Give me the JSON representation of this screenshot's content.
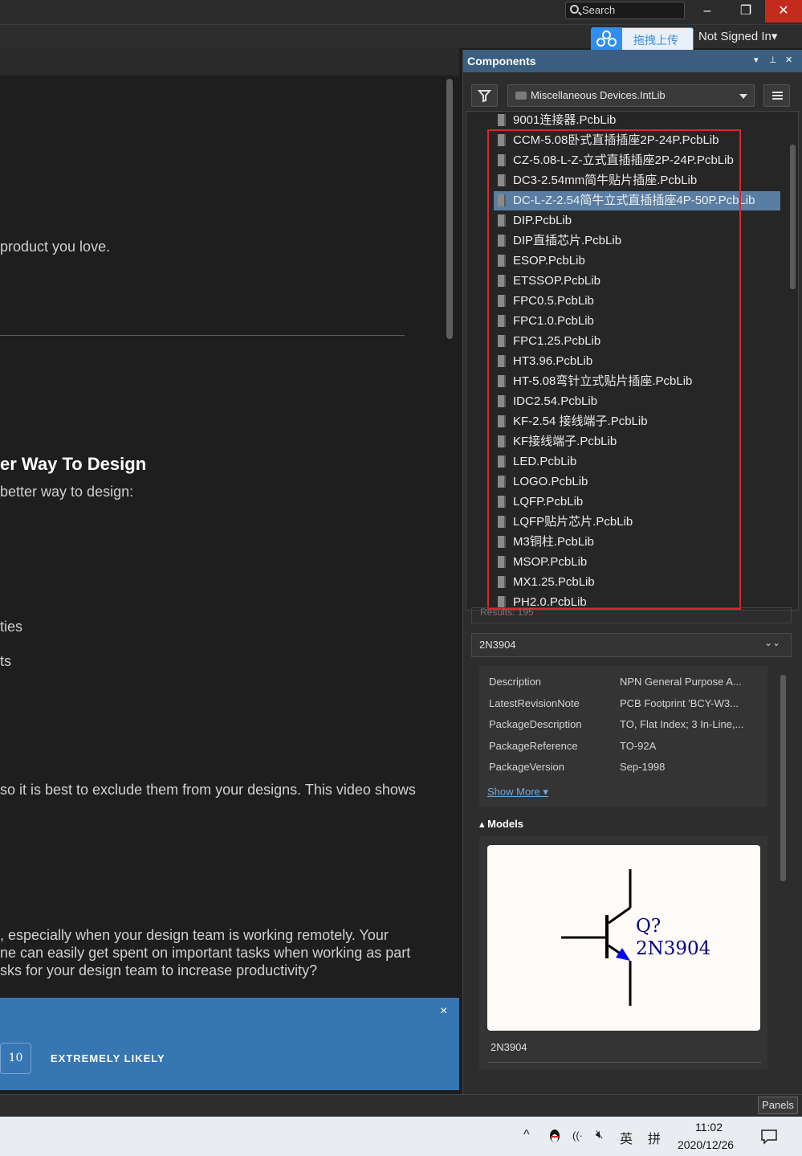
{
  "titlebar": {
    "search_label": "Search",
    "minimize": "–",
    "restore": "❐",
    "close": "✕"
  },
  "upload_button": {
    "label": "拖拽上传"
  },
  "account": {
    "label": "Not Signed In▾"
  },
  "left_content": {
    "line1": "product you love.",
    "heading": "er Way To Design",
    "subheading": "better way to design:",
    "item1": "ties",
    "item2": "ts",
    "para1": "so it is best to exclude them from your designs. This video shows",
    "para2_l1": ", especially when your design team is working remotely. Your",
    "para2_l2": "ne can easily get spent on important tasks when working as part",
    "para2_l3": "sks for your design team to increase productivity?",
    "survey_close": "×",
    "rating_value": "10",
    "rating_label": "EXTREMELY LIKELY"
  },
  "components": {
    "title": "Components",
    "header_icons": [
      "▾",
      "⊥",
      "✕"
    ],
    "library": "Miscellaneous Devices.IntLib",
    "items": [
      "9001连接器.PcbLib",
      "CCM-5.08卧式直插插座2P-24P.PcbLib",
      "CZ-5.08-L-Z-立式直插插座2P-24P.PcbLib",
      "DC3-2.54mm简牛贴片插座.PcbLib",
      "DC-L-Z-2.54简牛立式直插插座4P-50P.PcbLib",
      "DIP.PcbLib",
      "DIP直插芯片.PcbLib",
      "ESOP.PcbLib",
      "ETSSOP.PcbLib",
      "FPC0.5.PcbLib",
      "FPC1.0.PcbLib",
      "FPC1.25.PcbLib",
      "HT3.96.PcbLib",
      "HT-5.08弯针立式贴片插座.PcbLib",
      "IDC2.54.PcbLib",
      "KF-2.54 接线端子.PcbLib",
      "KF接线端子.PcbLib",
      "LED.PcbLib",
      "LOGO.PcbLib",
      "LQFP.PcbLib",
      "LQFP贴片芯片.PcbLib",
      "M3铜柱.PcbLib",
      "MSOP.PcbLib",
      "MX1.25.PcbLib",
      "PH2.0.PcbLib"
    ],
    "selected_index": 4,
    "results": "Results: 195",
    "details": {
      "name": "2N3904",
      "chevron": "⌄⌄",
      "properties": [
        {
          "key": "Description",
          "value": "NPN General Purpose A..."
        },
        {
          "key": "LatestRevisionNote",
          "value": "PCB Footprint 'BCY-W3..."
        },
        {
          "key": "PackageDescription",
          "value": "TO, Flat Index; 3 In-Line,..."
        },
        {
          "key": "PackageReference",
          "value": "TO-92A"
        },
        {
          "key": "PackageVersion",
          "value": "Sep-1998"
        }
      ],
      "show_more": "Show More ▾",
      "models_label": "▴ Models",
      "symbol_designator": "Q?",
      "symbol_comment": "2N3904",
      "model_name": "2N3904"
    }
  },
  "statusbar": {
    "panels": "Panels"
  },
  "taskbar": {
    "chevron": "^",
    "network": "((·",
    "volume": "🔇︎",
    "ime_lang": "英",
    "ime_mode": "拼",
    "time": "11:02",
    "date": "2020/12/26"
  },
  "colors": {
    "accent_header": "#3b5e80",
    "selection": "#5a7ea3",
    "highlight_box": "#d8262d",
    "survey_bg": "#3676b3",
    "close_btn": "#c42b1c"
  }
}
